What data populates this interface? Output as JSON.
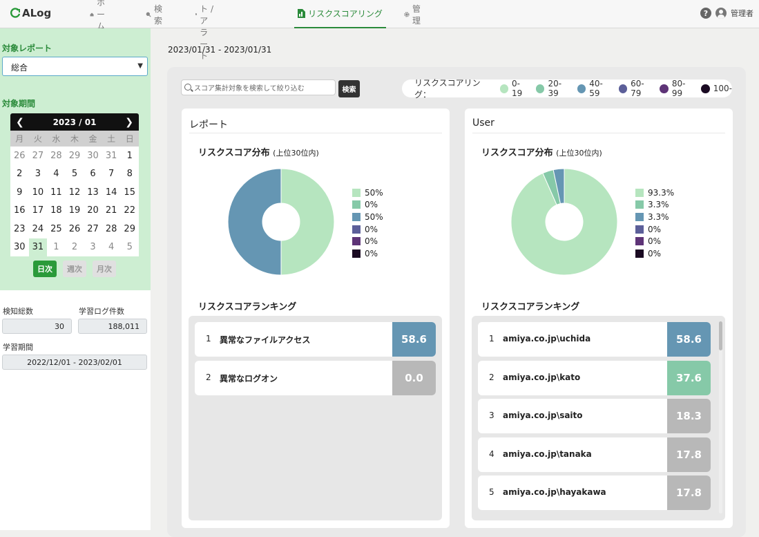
{
  "app": {
    "logo": "ALog",
    "user": "管理者"
  },
  "nav": [
    {
      "label": "ホーム",
      "icon": "home-icon"
    },
    {
      "label": "検索",
      "icon": "search-icon"
    },
    {
      "label": "レポート / アラート",
      "icon": "report-icon"
    },
    {
      "label": "リスクスコアリング",
      "icon": "risk-icon",
      "active": true
    },
    {
      "label": "管理",
      "icon": "gear-icon"
    }
  ],
  "sidebar": {
    "report_label": "対象レポート",
    "report_value": "総合",
    "period_label": "対象期間",
    "calendar": {
      "month": "2023 / 01",
      "dow": [
        "月",
        "火",
        "水",
        "木",
        "金",
        "土",
        "日"
      ],
      "days": [
        "26",
        "27",
        "28",
        "29",
        "30",
        "31",
        "1",
        "2",
        "3",
        "4",
        "5",
        "6",
        "7",
        "8",
        "9",
        "10",
        "11",
        "12",
        "13",
        "14",
        "15",
        "16",
        "17",
        "18",
        "19",
        "20",
        "21",
        "22",
        "23",
        "24",
        "25",
        "26",
        "27",
        "28",
        "29",
        "30",
        "31",
        "1",
        "2",
        "3",
        "4",
        "5"
      ]
    },
    "modes": [
      "日次",
      "週次",
      "月次"
    ],
    "detect_label": "検知総数",
    "detect_value": "30",
    "learnlog_label": "学習ログ件数",
    "learnlog_value": "188,011",
    "learnperiod_label": "学習期間",
    "learnperiod_value": "2022/12/01 - 2023/02/01"
  },
  "main": {
    "date_range": "2023/01/31 - 2023/01/31",
    "search_placeholder": "スコア集計対象を検索して絞り込む",
    "search_button": "検索",
    "legend_label": "リスクスコアリング：",
    "legend": [
      {
        "label": "0-19",
        "color": "#b6e5bf"
      },
      {
        "label": "20-39",
        "color": "#86c9a8"
      },
      {
        "label": "40-59",
        "color": "#6596b3"
      },
      {
        "label": "60-79",
        "color": "#5c5f99"
      },
      {
        "label": "80-99",
        "color": "#5e3477"
      },
      {
        "label": "100-",
        "color": "#1a0a22"
      }
    ]
  },
  "cards": [
    {
      "title": "レポート",
      "dist_title": "リスクスコア分布",
      "dist_sub": "(上位30位内)",
      "pie_values": [
        "50%",
        "0%",
        "50%",
        "0%",
        "0%",
        "0%"
      ],
      "rank_title": "リスクスコアランキング",
      "ranking": [
        {
          "rank": "1",
          "name": "異常なファイルアクセス",
          "score": "58.6",
          "color": "#6596b3"
        },
        {
          "rank": "2",
          "name": "異常なログオン",
          "score": "0.0",
          "color": "#b8b8b8"
        }
      ]
    },
    {
      "title": "User",
      "dist_title": "リスクスコア分布",
      "dist_sub": "(上位30位内)",
      "pie_values": [
        "93.3%",
        "3.3%",
        "3.3%",
        "0%",
        "0%",
        "0%"
      ],
      "rank_title": "リスクスコアランキング",
      "ranking": [
        {
          "rank": "1",
          "name": "amiya.co.jp\\uchida",
          "score": "58.6",
          "color": "#6596b3"
        },
        {
          "rank": "2",
          "name": "amiya.co.jp\\kato",
          "score": "37.6",
          "color": "#86c9a8"
        },
        {
          "rank": "3",
          "name": "amiya.co.jp\\saito",
          "score": "18.3",
          "color": "#b8b8b8"
        },
        {
          "rank": "4",
          "name": "amiya.co.jp\\tanaka",
          "score": "17.8",
          "color": "#b8b8b8"
        },
        {
          "rank": "5",
          "name": "amiya.co.jp\\hayakawa",
          "score": "17.8",
          "color": "#b8b8b8"
        }
      ]
    }
  ]
}
